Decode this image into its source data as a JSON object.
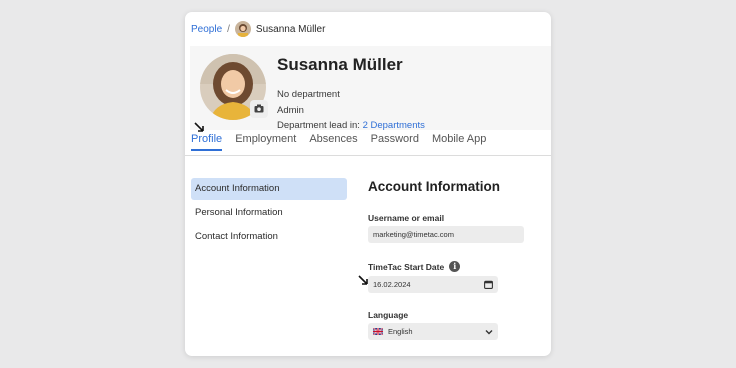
{
  "breadcrumb": {
    "parent": "People",
    "separator": "/",
    "current": "Susanna Müller"
  },
  "profile": {
    "name": "Susanna Müller",
    "department": "No department",
    "role": "Admin",
    "lead_label": "Department lead in:",
    "lead_link": "2 Departments"
  },
  "tabs": [
    {
      "label": "Profile",
      "active": true
    },
    {
      "label": "Employment"
    },
    {
      "label": "Absences"
    },
    {
      "label": "Password"
    },
    {
      "label": "Mobile App"
    }
  ],
  "sidebar": {
    "items": [
      {
        "label": "Account Information",
        "active": true
      },
      {
        "label": "Personal Information"
      },
      {
        "label": "Contact Information"
      }
    ]
  },
  "form": {
    "title": "Account Information",
    "username_label": "Username or email",
    "username_value": "marketing@timetac.com",
    "start_date_label": "TimeTac Start Date",
    "start_date_value": "16.02.2024",
    "language_label": "Language",
    "language_value": "English"
  },
  "colors": {
    "accent": "#2f6fd6",
    "active_nav_bg": "#cfe0f7",
    "field_bg": "#ececec"
  },
  "icons": [
    "camera-icon",
    "info-icon",
    "calendar-icon",
    "chevron-down-icon",
    "uk-flag-icon",
    "cursor-arrow-icon"
  ]
}
